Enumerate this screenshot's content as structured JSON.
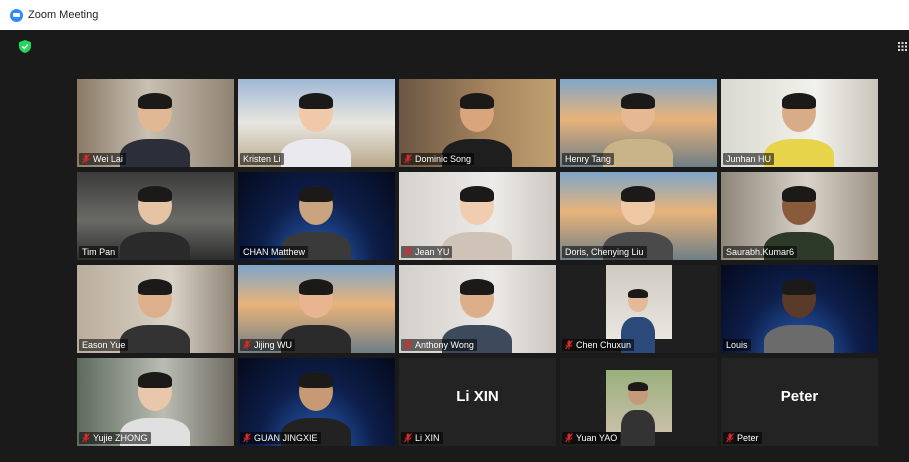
{
  "window": {
    "title": "Zoom Meeting"
  },
  "participants": [
    {
      "name": "Wei Lai",
      "muted": true
    },
    {
      "name": "Kristen Li",
      "muted": false
    },
    {
      "name": "Dominic Song",
      "muted": true
    },
    {
      "name": "Henry Tang",
      "muted": false
    },
    {
      "name": "Junhan HU",
      "muted": false,
      "active_speaker": true
    },
    {
      "name": "Tim Pan",
      "muted": false
    },
    {
      "name": "CHAN Matthew",
      "muted": false
    },
    {
      "name": "Jean YU",
      "muted": true
    },
    {
      "name": "Doris, Chenying Liu",
      "muted": false
    },
    {
      "name": "Saurabh.Kumar6",
      "muted": false
    },
    {
      "name": "Eason Yue",
      "muted": false
    },
    {
      "name": "Jijing WU",
      "muted": true
    },
    {
      "name": "Anthony Wong",
      "muted": true
    },
    {
      "name": "Chen Chuxun",
      "muted": true
    },
    {
      "name": "Louis",
      "muted": false
    },
    {
      "name": "Yujie ZHONG",
      "muted": true
    },
    {
      "name": "GUAN JINGXIE",
      "muted": true
    },
    {
      "name": "Li XIN",
      "muted": true,
      "video_off": true,
      "display_name": "Li XIN"
    },
    {
      "name": "Yuan YAO",
      "muted": true
    },
    {
      "name": "Peter",
      "muted": true,
      "video_off": true,
      "display_name": "Peter"
    }
  ],
  "colors": {
    "active_speaker_border": "#c8f000",
    "mic_off": "#e02828",
    "meeting_bg": "#1a1a1a",
    "security_shield": "#23d959"
  },
  "icons": {
    "security": "shield-check-icon",
    "view": "grid-view-icon",
    "mic": "mic-off-icon"
  }
}
